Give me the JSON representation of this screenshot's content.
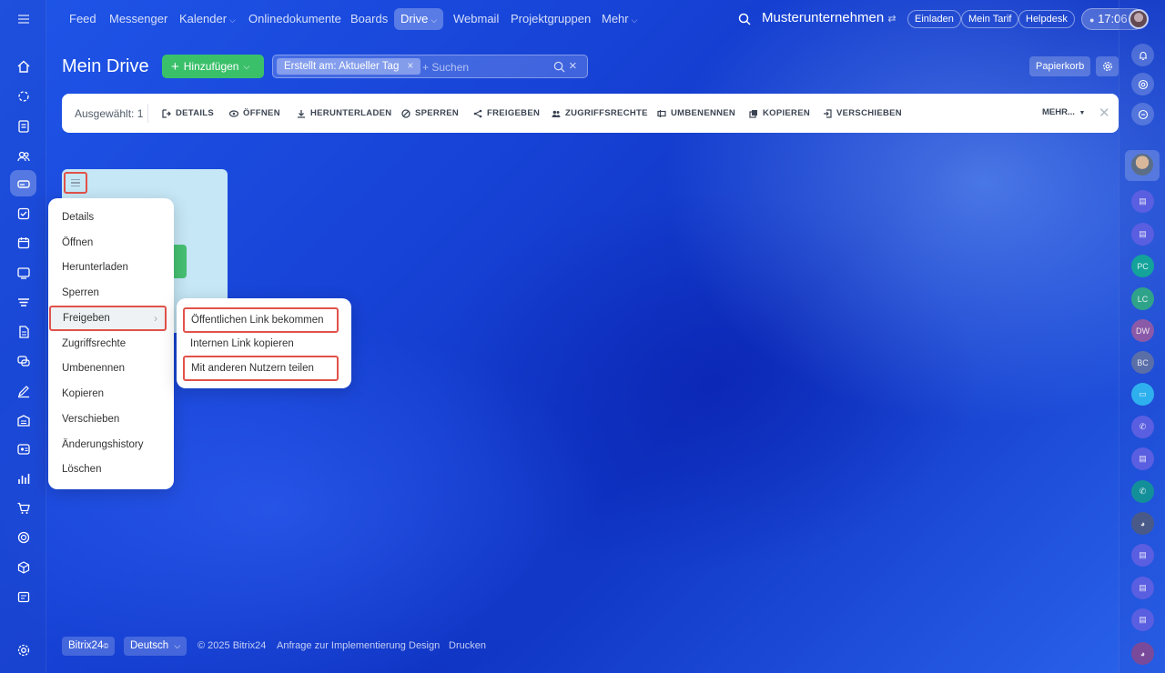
{
  "topnav": {
    "items": [
      {
        "label": "Feed"
      },
      {
        "label": "Messenger"
      },
      {
        "label": "Kalender"
      },
      {
        "label": "Onlinedokumente"
      },
      {
        "label": "Boards"
      },
      {
        "label": "Drive"
      },
      {
        "label": "Webmail"
      },
      {
        "label": "Projektgruppen"
      },
      {
        "label": "Mehr"
      }
    ],
    "company": "Musterunternehmen",
    "invite": "Einladen",
    "plan": "Mein Tarif",
    "helpdesk": "Helpdesk",
    "time": "17:06"
  },
  "header": {
    "title": "Mein Drive",
    "add_label": "Hinzufügen",
    "filter_chip": "Erstellt am: Aktueller Tag",
    "search_placeholder": "+ Suchen",
    "trash": "Papierkorb"
  },
  "toolbar": {
    "selected": "Ausgewählt: 1",
    "actions": [
      {
        "label": "DETAILS"
      },
      {
        "label": "ÖFFNEN"
      },
      {
        "label": "HERUNTERLADEN"
      },
      {
        "label": "SPERREN"
      },
      {
        "label": "FREIGEBEN"
      },
      {
        "label": "ZUGRIFFSRECHTE"
      },
      {
        "label": "UMBENENNEN"
      },
      {
        "label": "KOPIEREN"
      },
      {
        "label": "VERSCHIEBEN"
      }
    ],
    "more": "MEHR..."
  },
  "context_menu": {
    "items": [
      {
        "label": "Details"
      },
      {
        "label": "Öffnen"
      },
      {
        "label": "Herunterladen"
      },
      {
        "label": "Sperren"
      },
      {
        "label": "Freigeben"
      },
      {
        "label": "Zugriffsrechte"
      },
      {
        "label": "Umbenennen"
      },
      {
        "label": "Kopieren"
      },
      {
        "label": "Verschieben"
      },
      {
        "label": "Änderungshistory"
      },
      {
        "label": "Löschen"
      }
    ],
    "submenu": [
      {
        "label": "Öffentlichen Link bekommen"
      },
      {
        "label": "Internen Link kopieren"
      },
      {
        "label": "Mit anderen Nutzern teilen"
      }
    ]
  },
  "right_sidebar": {
    "initials": [
      "PC",
      "LC",
      "DW",
      "BC"
    ]
  },
  "footer": {
    "brand": "Bitrix24",
    "language": "Deutsch",
    "copyright": "© 2025 Bitrix24",
    "links": [
      "Anfrage zur Implementierung",
      "Design",
      "Drucken"
    ]
  },
  "colors": {
    "accent_green": "#3bc06a",
    "highlight_red": "#e2524a",
    "tile_blue": "#c6e7f6"
  }
}
